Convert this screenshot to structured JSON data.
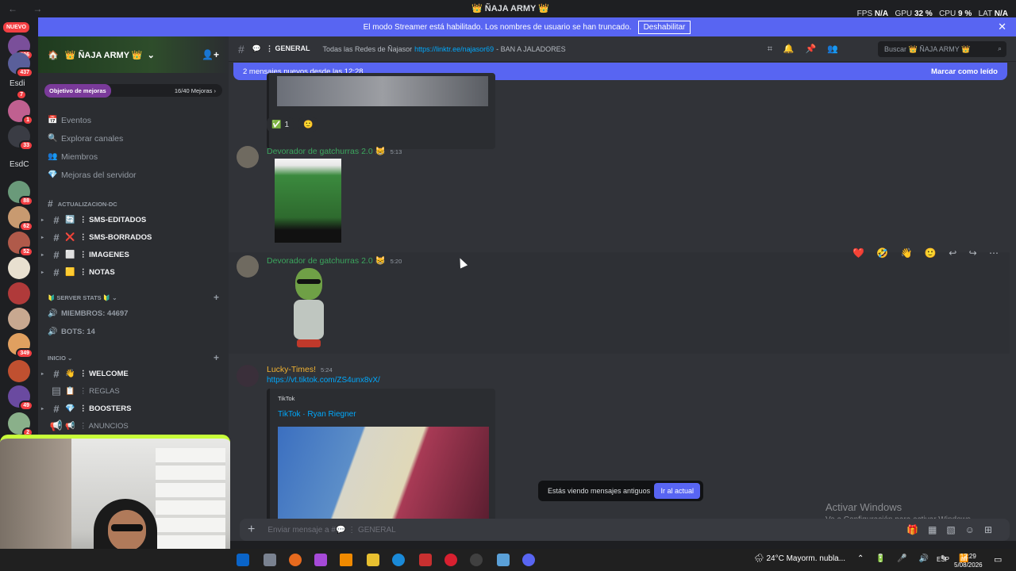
{
  "titlebar": {
    "title": "👑 ÑAJA ARMY 👑",
    "nav": "← →",
    "fps_label": "FPS",
    "fps_value": "N/A",
    "gpu_label": "GPU",
    "gpu_value": "32 %",
    "cpu_label": "CPU",
    "cpu_value": "9 %",
    "lat_label": "LAT",
    "lat_value": "N/A"
  },
  "banner": {
    "text": "El modo Streamer está habilitado. Los nombres de usuario se han truncado.",
    "button": "Deshabilitar",
    "close": "✕"
  },
  "guilds": {
    "new_label": "NUEVO",
    "badges": [
      "336",
      "437",
      "7",
      "1",
      "33",
      "88",
      "62",
      "52",
      "349",
      "49",
      "2"
    ],
    "text_items": [
      "Esdi",
      "EsdC"
    ]
  },
  "sidebar": {
    "server_name": "👑 ÑAJA ARMY 👑",
    "chevron": "⌄",
    "invite_icon": "👤+",
    "boost_label": "Objetivo de mejoras",
    "boost_progress": "16/40 Mejoras ›",
    "nav": [
      {
        "icon": "📅",
        "label": "Eventos"
      },
      {
        "icon": "🔍",
        "label": "Explorar canales"
      },
      {
        "icon": "👥",
        "label": "Miembros"
      },
      {
        "icon": "💎",
        "label": "Mejoras del servidor"
      }
    ],
    "categories": [
      {
        "label": "ACTUALIZACION-DC"
      },
      {
        "label": "🔰 SERVER STATS 🔰 ⌄"
      },
      {
        "label": "INICIO ⌄"
      }
    ],
    "channels_update": [
      {
        "emoji": "🔄",
        "label": "⋮ SMS-EDITADOS"
      },
      {
        "emoji": "❌",
        "label": "⋮ SMS-BORRADOS"
      },
      {
        "emoji": "⬜",
        "label": "⋮ IMAGENES"
      },
      {
        "emoji": "🟨",
        "label": "⋮ NOTAS"
      }
    ],
    "stats": [
      {
        "icon": "🔊",
        "label": "MIEMBROS: 44697"
      },
      {
        "icon": "🔊",
        "label": "BOTS: 14"
      }
    ],
    "channels_inicio": [
      {
        "emoji": "👋",
        "label": "⋮ WELCOME"
      },
      {
        "emoji": "📋",
        "label": "⋮ REGLAS"
      },
      {
        "emoji": "💎",
        "label": "⋮ BOOSTERS"
      },
      {
        "emoji": "📢",
        "label": "⋮ ANUNCIOS"
      }
    ]
  },
  "header": {
    "channel": "⋮ GENERAL",
    "topic_prefix": "Todas las Redes de Ñajasor",
    "topic_link": "https://linktr.ee/najasor69",
    "topic_suffix": "- BAN A JALADORES",
    "search_placeholder": "Buscar 👑 ÑAJA ARMY 👑"
  },
  "newbar": {
    "text": "2 mensajes nuevos desde las 12:28",
    "mark": "Marcar como leído"
  },
  "reactions": [
    {
      "emoji": "✅",
      "count": "1"
    },
    {
      "emoji": "🙂",
      "count": ""
    }
  ],
  "messages": [
    {
      "author": "Devorador de gatchurras 2.0 😸",
      "time": "5:13",
      "author_color": "#3ba55d"
    },
    {
      "author": "Devorador de gatchurras 2.0 😸",
      "time": "5:20",
      "author_color": "#3ba55d"
    },
    {
      "author": "Lucky-Times!",
      "time": "5:24",
      "author_color": "#f0b232",
      "link": "https://vt.tiktok.com/ZS4unx8vX/"
    }
  ],
  "embed": {
    "provider": "TikTok",
    "title": "TikTok · Ryan Riegner"
  },
  "toolbar": "❤️ 🤣 👋 🙂 ↩ ↪ ⋯",
  "toast": {
    "text": "Estás viendo mensajes antiguos",
    "button": "Ir al actual"
  },
  "composer": {
    "placeholder": "Enviar mensaje a #💬 ⋮ GENERAL"
  },
  "watermark": {
    "line1": "Activar Windows",
    "line2": "Ve a Configuración para activar Windows."
  },
  "taskbar": {
    "weather": "🌧 24°C  Mayorm. nubla...",
    "tray": "⌃ 🔋 🎤 🔊 ✎ 📶",
    "lang": "ESP",
    "time": "12:29",
    "date": "5/08/2026",
    "notif": "▭"
  }
}
